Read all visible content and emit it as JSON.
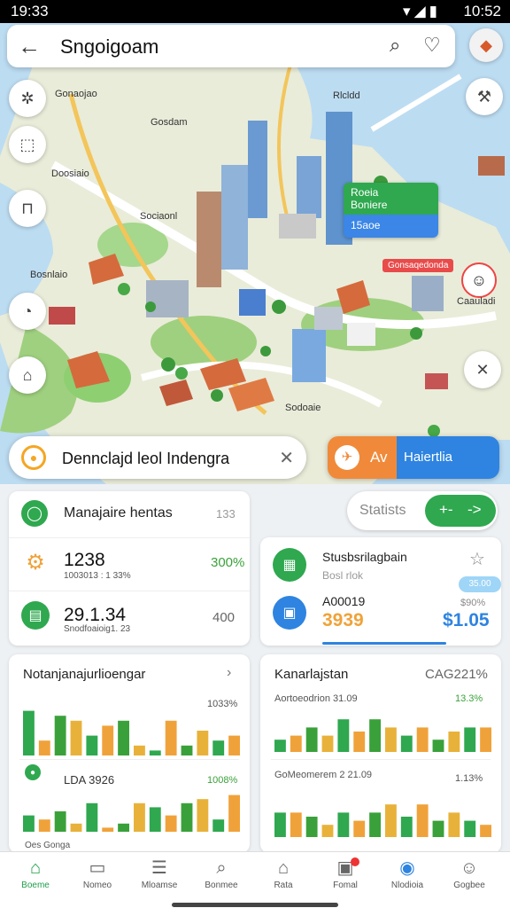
{
  "status": {
    "left": "19:33",
    "time": "10:52"
  },
  "header": {
    "title": "Sngoigoam"
  },
  "map": {
    "labels": [
      "Gonaojao",
      "Gosdam",
      "Doosiaio",
      "Sociaonl",
      "Bosnlaio",
      "Sodoaie",
      "Rlcldd"
    ],
    "green_card": {
      "line1": "Roeia",
      "line2": "Boniere",
      "line3": "15aoe"
    },
    "red_tag": "Gonsaqedonda",
    "pin_label": "Caauladi"
  },
  "location": {
    "text": "Dennclajd leol Indengra"
  },
  "action": {
    "left": "Av",
    "right": "Haiertlia"
  },
  "card1": {
    "title": "Manajaire hentas",
    "right": "133",
    "row1": {
      "value": "1238",
      "sub": "1003013 : 1 33%",
      "right": "300%"
    },
    "row2": {
      "value": "29.1.34",
      "sub": "Snodfoaioig1. 23",
      "right": "400"
    }
  },
  "stats": {
    "label": "Statists",
    "pill_left": "+-",
    "pill_right": "->"
  },
  "card2": {
    "title": "Stusbsrilagbain",
    "sub": "Bosl rlok",
    "code": "A00019",
    "value": "3939",
    "bubble": "35.00",
    "percent": "$90%",
    "price": "$1.05"
  },
  "card3": {
    "title": "Notanjanajurlioengar",
    "pct1": "1033%",
    "label2": "LDA 3926",
    "pct2": "1008%",
    "footer": "Oes Gonga"
  },
  "card4": {
    "title": "Kanarlajstan",
    "right": "CAG221%",
    "sub1": "Aortoeodrion 31.09",
    "pct1": "13.3%",
    "sub2": "GoMeomerem 2 21.09",
    "pct2": "1.13%"
  },
  "nav": [
    {
      "label": "Boeme",
      "icon": "home-icon"
    },
    {
      "label": "Nomeo",
      "icon": "doc-icon"
    },
    {
      "label": "Mloamse",
      "icon": "chat-icon"
    },
    {
      "label": "Bonmee",
      "icon": "search-icon"
    },
    {
      "label": "Rata",
      "icon": "house-icon"
    },
    {
      "label": "Fomal",
      "icon": "tray-icon"
    },
    {
      "label": "Nlodioia",
      "icon": "globe-icon"
    },
    {
      "label": "Gogbee",
      "icon": "user-icon"
    }
  ],
  "chart_data": [
    {
      "type": "bar",
      "title": "Notanjanajurlioengar",
      "series": [
        {
          "values": [
            9,
            3,
            8,
            7,
            4,
            6,
            7,
            2,
            1,
            7,
            2,
            5,
            3,
            4
          ]
        }
      ]
    },
    {
      "type": "bar",
      "title": "Kanarlajstan",
      "series": [
        {
          "values": [
            3,
            4,
            6,
            4,
            8,
            5,
            8,
            6,
            4,
            6,
            3,
            5,
            6,
            6
          ]
        }
      ]
    }
  ]
}
